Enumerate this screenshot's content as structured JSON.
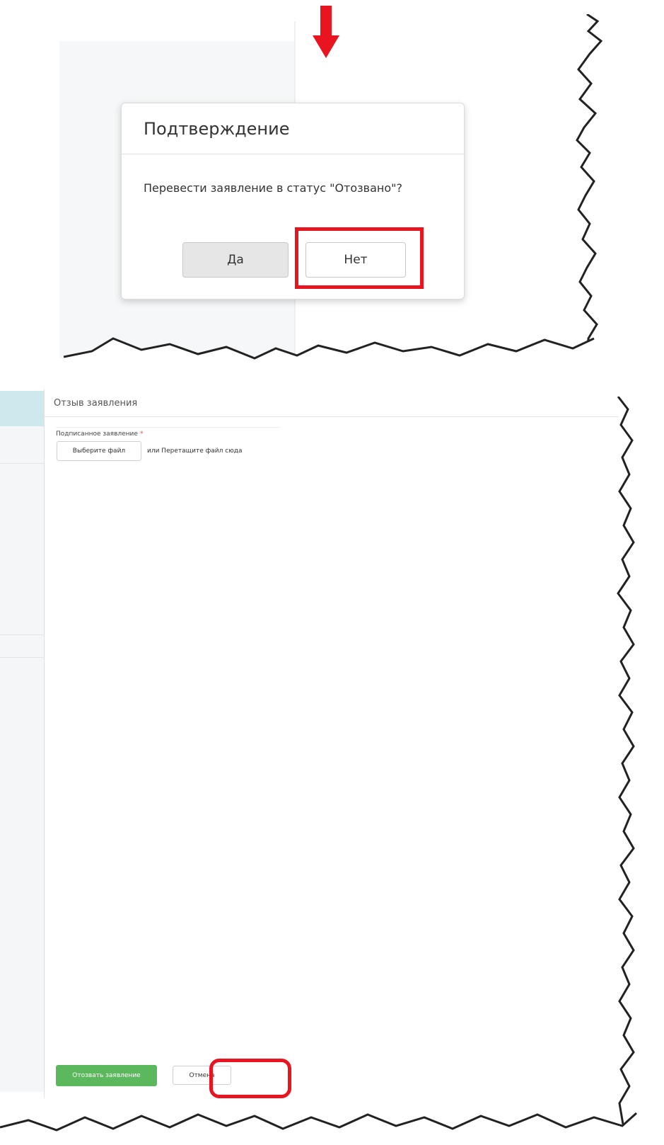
{
  "colors": {
    "highlight": "#e8141f",
    "arrow": "#e8141f",
    "primary_green": "#5cb85c",
    "header_blue": "#cde9ee"
  },
  "confirm_dialog": {
    "title": "Подтверждение",
    "message": "Перевести заявление в статус \"Отозвано\"?",
    "yes_label": "Да",
    "no_label": "Нет"
  },
  "withdraw_form": {
    "title": "Отзыв заявления",
    "file_field": {
      "label": "Подписанное заявление",
      "required_mark": "*",
      "choose_button": "Выберите файл",
      "drop_hint": "или Перетащите файл сюда"
    },
    "submit_label": "Отозвать заявление",
    "cancel_label": "Отмена"
  },
  "icons": {
    "arrow": "arrow-down-icon"
  }
}
